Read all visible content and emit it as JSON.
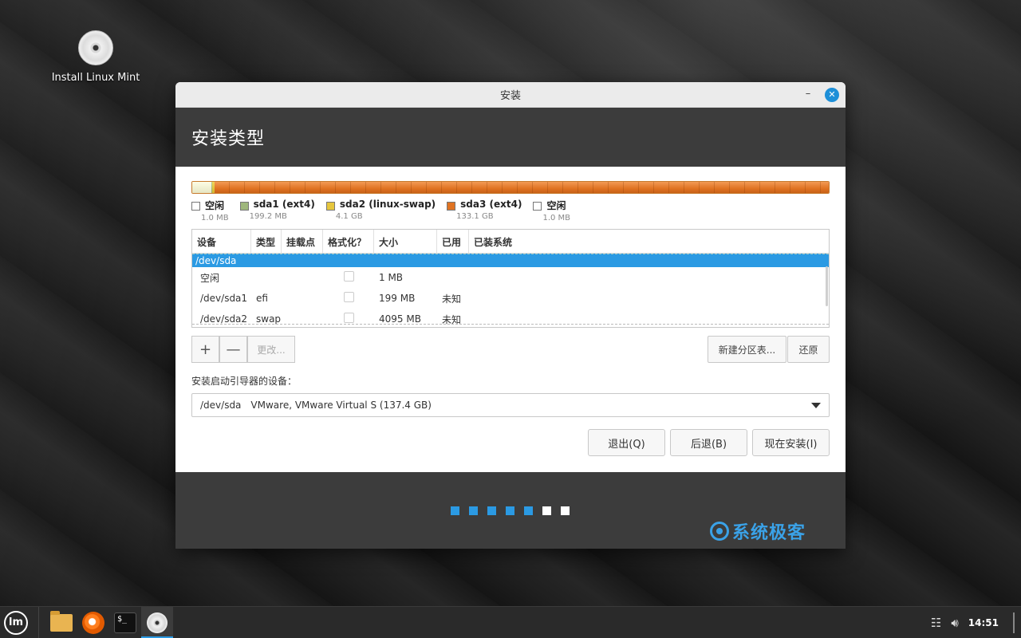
{
  "desktop": {
    "icon_label": "Install Linux Mint"
  },
  "window": {
    "title": "安装",
    "minimize_symbol": "–",
    "close_symbol": "✕",
    "heading": "安装类型"
  },
  "partition_bar": {
    "colors": {
      "free": "#f5f5d6",
      "sda1": "#9fb77c",
      "sda2": "#e6c63d",
      "sda3": "#e07322"
    },
    "legend": [
      {
        "name": "空闲",
        "size": "1.0 MB",
        "color": "#ffffff"
      },
      {
        "name": "sda1 (ext4)",
        "size": "199.2 MB",
        "color": "#9fb77c"
      },
      {
        "name": "sda2 (linux-swap)",
        "size": "4.1 GB",
        "color": "#e6c63d"
      },
      {
        "name": "sda3 (ext4)",
        "size": "133.1 GB",
        "color": "#e07322"
      },
      {
        "name": "空闲",
        "size": "1.0 MB",
        "color": "#ffffff"
      }
    ]
  },
  "table": {
    "headers": [
      "设备",
      "类型",
      "挂载点",
      "格式化？",
      "大小",
      "已用",
      "已装系统"
    ],
    "disk": "/dev/sda",
    "rows": [
      {
        "device": "空闲",
        "type": "",
        "mount": "",
        "size": "1 MB",
        "used": "",
        "system": ""
      },
      {
        "device": "/dev/sda1",
        "type": "efi",
        "mount": "",
        "size": "199 MB",
        "used": "未知",
        "system": ""
      },
      {
        "device": "/dev/sda2",
        "type": "swap",
        "mount": "",
        "size": "4095 MB",
        "used": "未知",
        "system": ""
      }
    ]
  },
  "toolbar": {
    "add_symbol": "+",
    "remove_symbol": "—",
    "change_label": "更改...",
    "new_table_label": "新建分区表...",
    "revert_label": "还原"
  },
  "bootloader": {
    "label": "安装启动引导器的设备：",
    "device": "/dev/sda",
    "description": "VMware, VMware Virtual S (137.4 GB)"
  },
  "actions": {
    "quit_label": "退出(Q)",
    "back_label": "后退(B)",
    "install_label": "现在安装(I)"
  },
  "progress": {
    "done_steps": 5,
    "total_steps": 7,
    "active_color": "#2b9ae3"
  },
  "watermark": "系统极客",
  "taskbar": {
    "mint_label": "lm",
    "terminal_label": "$_",
    "clock": "14:51"
  }
}
